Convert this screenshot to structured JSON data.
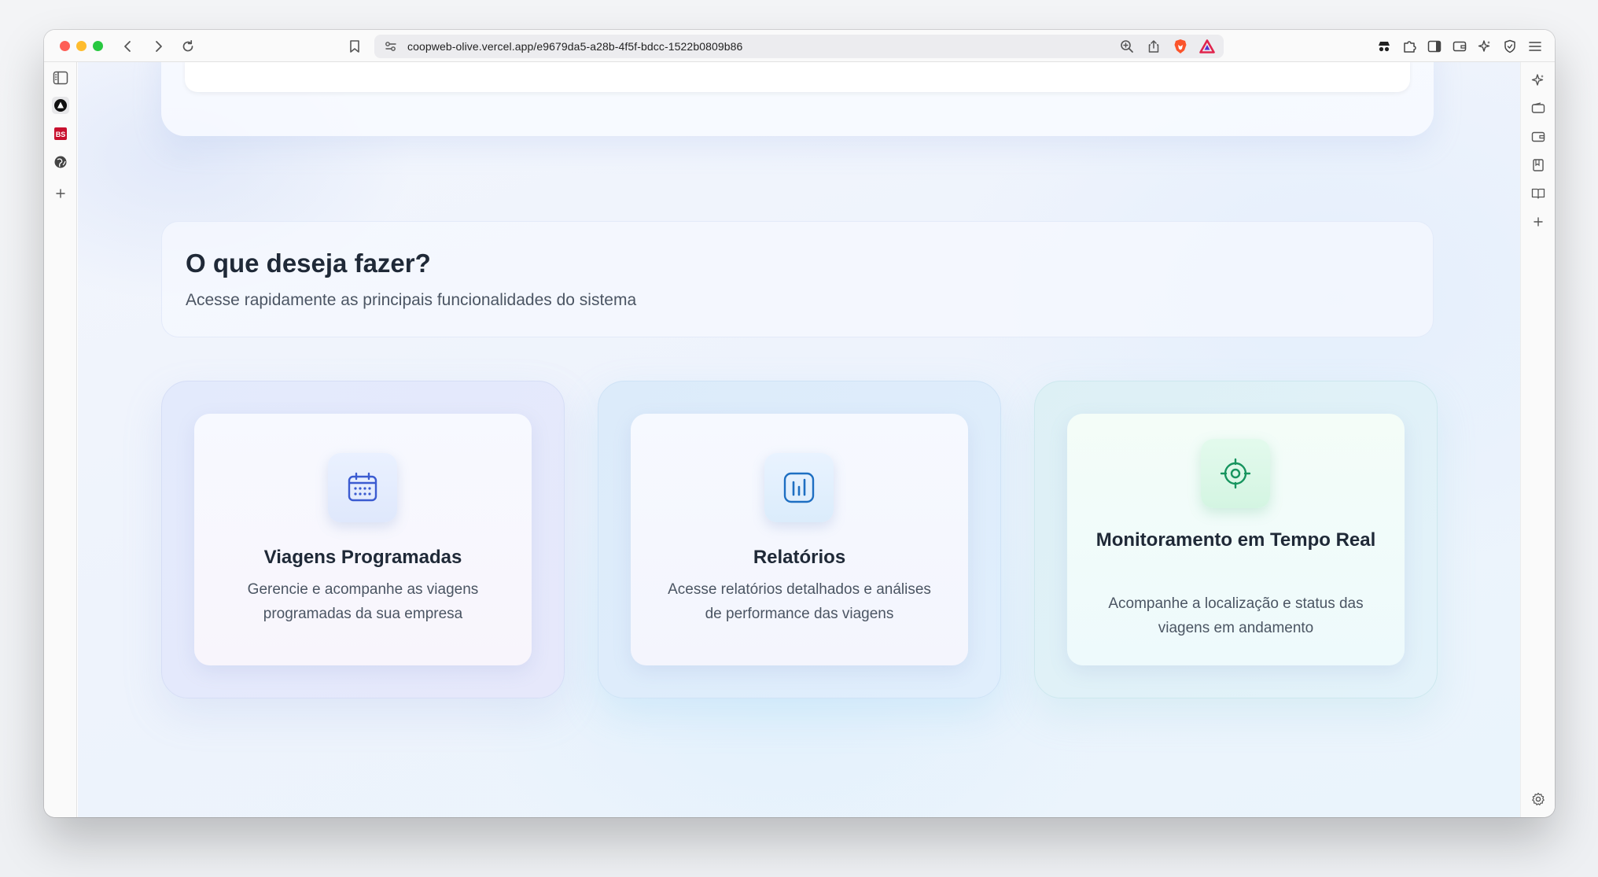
{
  "browser": {
    "url": "coopweb-olive.vercel.app/e9679da5-a28b-4f5f-bdcc-1522b0809b86",
    "left_sidebar_icons": [
      "sidebar-toggle-icon",
      "app-a-icon",
      "bs-app-icon",
      "globe-icon",
      "plus-icon"
    ],
    "right_sidebar_icons": [
      "leo-star-icon",
      "wallet-icon",
      "wallet-alt-icon",
      "bookmarks-icon",
      "reading-list-icon",
      "plus-icon",
      "settings-gear-icon"
    ],
    "colors": {
      "close": "#fe5f57",
      "minimize": "#febc2e",
      "maximize": "#28c840",
      "brave_shield": "#fb542b"
    }
  },
  "section": {
    "title": "O que deseja fazer?",
    "subtitle": "Acesse rapidamente as principais funcionalidades do sistema"
  },
  "cards": [
    {
      "icon": "calendar-icon",
      "title": "Viagens Programadas",
      "description": "Gerencie e acompanhe as viagens programadas da sua empresa",
      "accent": "#3b5bd1"
    },
    {
      "icon": "bar-chart-icon",
      "title": "Relatórios",
      "description": "Acesse relatórios detalhados e análises de performance das viagens",
      "accent": "#1e6fc2"
    },
    {
      "icon": "target-icon",
      "title": "Monitoramento em Tempo Real",
      "description": "Acompanhe a localização e status das viagens em andamento",
      "accent": "#16945e"
    }
  ]
}
